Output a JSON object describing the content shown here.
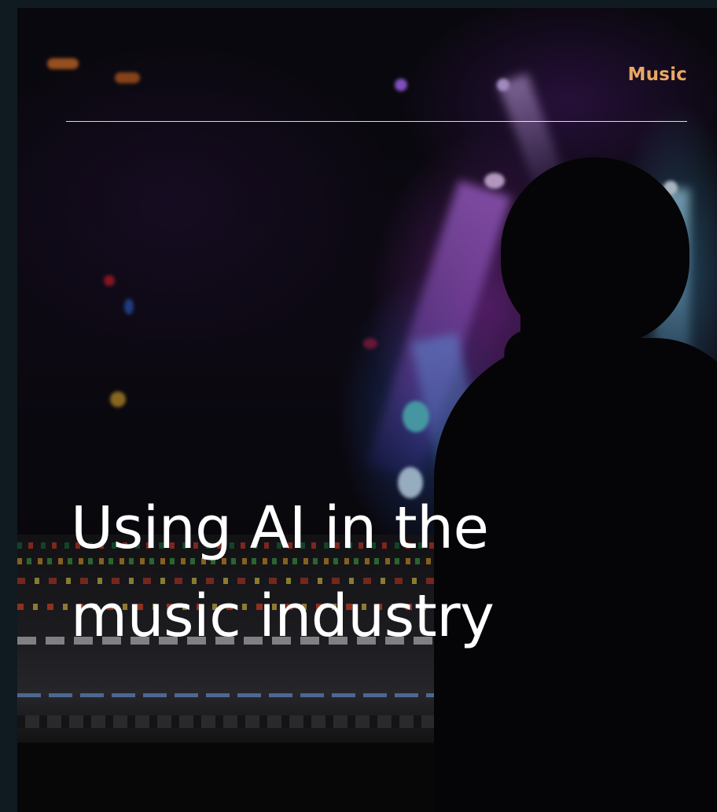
{
  "card": {
    "category": "Music",
    "title_line_1": "Using AI in the",
    "title_line_2": "music industry",
    "background_image": "concert-mixing-desk-silhouette"
  },
  "colors": {
    "category": "#e9a764",
    "title": "#ffffff",
    "divider": "#ffffff",
    "frame": "#0f1b21"
  }
}
